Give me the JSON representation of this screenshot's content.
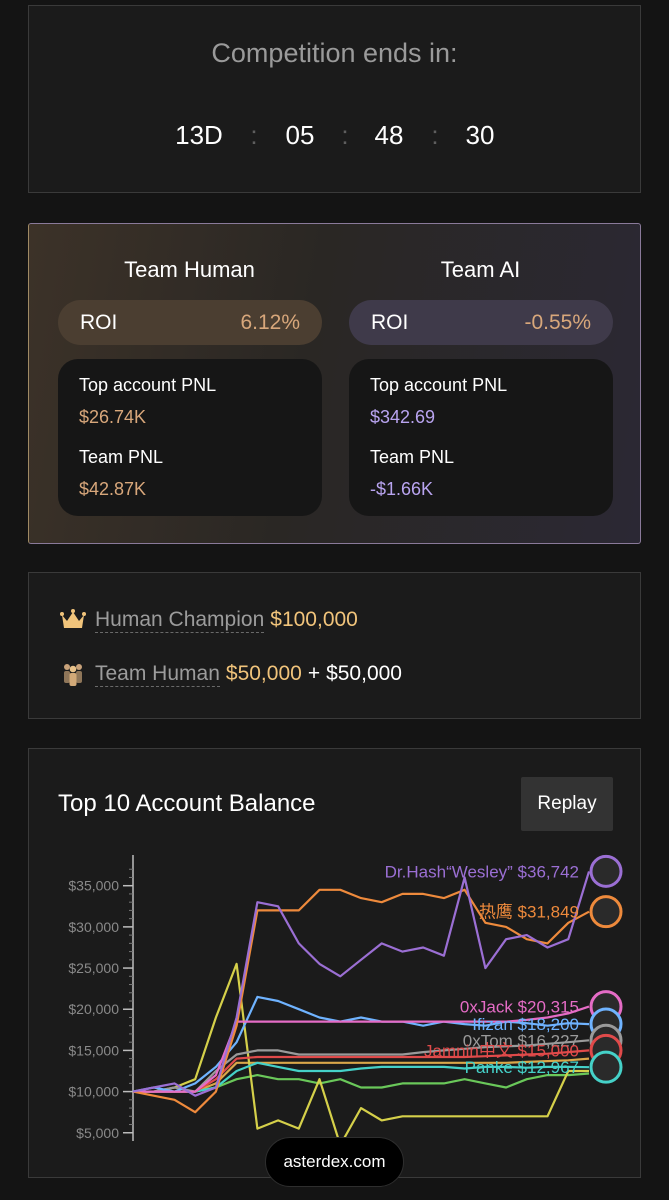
{
  "countdown": {
    "title": "Competition ends in:",
    "days": "13D",
    "hours": "05",
    "minutes": "48",
    "seconds": "30",
    "separator": ":"
  },
  "teams": [
    {
      "name": "Team Human",
      "roi_label": "ROI",
      "roi_value": "6.12%",
      "top_pnl_label": "Top account PNL",
      "top_pnl_value": "$26.74K",
      "team_pnl_label": "Team PNL",
      "team_pnl_value": "$42.87K",
      "accent": "#d8a77b"
    },
    {
      "name": "Team AI",
      "roi_label": "ROI",
      "roi_value": "-0.55%",
      "top_pnl_label": "Top account PNL",
      "top_pnl_value": "$342.69",
      "team_pnl_label": "Team PNL",
      "team_pnl_value": "-$1.66K",
      "accent": "#b9a4f0"
    }
  ],
  "prizes": {
    "champion_label": "Human Champion",
    "champion_amount": "$100,000",
    "team_label": "Team Human",
    "team_amount": "$50,000",
    "plus": "+",
    "team_bonus": "$50,000"
  },
  "chart_section": {
    "title": "Top 10 Account Balance",
    "replay_label": "Replay"
  },
  "chart_data": {
    "type": "line",
    "ylim": [
      4000,
      38000
    ],
    "yticks": [
      5000,
      10000,
      15000,
      20000,
      25000,
      30000,
      35000
    ],
    "ytick_labels": [
      "$5,000",
      "$10,000",
      "$15,000",
      "$20,000",
      "$25,000",
      "$30,000",
      "$35,000"
    ],
    "grid": false,
    "series": [
      {
        "name": "Dr.Hash“Wesley”",
        "label": "Dr.Hash“Wesley” $36,742",
        "final": 36742,
        "color": "#9b6fd4",
        "values": [
          10000,
          10500,
          11000,
          9500,
          10500,
          19000,
          33000,
          32500,
          28000,
          25500,
          24000,
          26000,
          28000,
          27000,
          27500,
          26500,
          36000,
          25000,
          28500,
          29000,
          27500,
          28500,
          36742
        ]
      },
      {
        "name": "热鹰",
        "label": "热鹰 $31,849",
        "final": 31849,
        "color": "#ee8a3c",
        "values": [
          10000,
          9500,
          9000,
          7500,
          10000,
          18000,
          32000,
          32000,
          32000,
          34500,
          34500,
          33500,
          33000,
          34000,
          34000,
          33500,
          34500,
          30500,
          30000,
          28500,
          28000,
          30500,
          31849
        ]
      },
      {
        "name": "0xJack",
        "label": "0xJack $20,315",
        "final": 20315,
        "color": "#e56cc6",
        "values": [
          10000,
          10000,
          10000,
          10000,
          12000,
          18500,
          18500,
          18500,
          18500,
          18500,
          18500,
          18500,
          18500,
          18500,
          18500,
          18500,
          18500,
          18500,
          18500,
          18700,
          19000,
          19500,
          20315
        ]
      },
      {
        "name": "Ifizan",
        "label": "Ifizan $18,200",
        "final": 18200,
        "color": "#6fb3ff",
        "values": [
          10000,
          10500,
          10000,
          11000,
          13000,
          16000,
          21500,
          21000,
          20000,
          19000,
          18500,
          19000,
          18500,
          18500,
          18000,
          18500,
          18200,
          18000,
          18500,
          18300,
          18000,
          18300,
          18200
        ]
      },
      {
        "name": "0xTom",
        "label": "0xTom $16,227",
        "final": 16227,
        "color": "#9a9a9a",
        "values": [
          10000,
          10000,
          10500,
          10000,
          12500,
          14500,
          15000,
          15000,
          14500,
          14500,
          14500,
          14500,
          14500,
          14500,
          14800,
          15000,
          15200,
          15400,
          15500,
          15600,
          15800,
          16000,
          16227
        ]
      },
      {
        "name": "Jamnin中文",
        "label": "Jamnin中文 $15,000",
        "final": 15000,
        "color": "#e04a4a",
        "values": [
          10000,
          10000,
          10000,
          10000,
          11500,
          14000,
          14200,
          14200,
          14200,
          14200,
          14200,
          14200,
          14200,
          14200,
          14200,
          14200,
          14200,
          14300,
          14400,
          14500,
          14600,
          14800,
          15000
        ]
      },
      {
        "name": "Panke",
        "label": "Panke $12,967",
        "final": 12967,
        "color": "#45d1c8",
        "values": [
          10000,
          10000,
          10000,
          10000,
          10500,
          12500,
          13500,
          13000,
          12500,
          12500,
          12500,
          12800,
          13000,
          13000,
          13000,
          13000,
          12800,
          13000,
          13000,
          12900,
          13000,
          13000,
          12967
        ]
      },
      {
        "name": "",
        "label": "",
        "final": 12500,
        "color": "#d5d04a",
        "values": [
          10000,
          10000,
          10500,
          11500,
          19000,
          25500,
          5500,
          6500,
          5500,
          11500,
          3500,
          8000,
          6500,
          7000,
          7000,
          7000,
          7000,
          7000,
          7000,
          7000,
          7000,
          12500,
          12500
        ]
      },
      {
        "name": "",
        "label": "",
        "final": 12200,
        "color": "#6ac85a",
        "values": [
          10000,
          10000,
          10000,
          10000,
          10500,
          11500,
          12000,
          11500,
          11500,
          11000,
          11500,
          10500,
          10500,
          11000,
          11000,
          11000,
          11500,
          11000,
          10500,
          11500,
          12000,
          12000,
          12200
        ]
      },
      {
        "name": "",
        "label": "",
        "final": 14000,
        "color": "#d9a74a",
        "values": [
          10000,
          10000,
          10000,
          10000,
          11000,
          13500,
          13500,
          13500,
          13500,
          13500,
          13500,
          13500,
          13500,
          13500,
          13500,
          13500,
          13500,
          13500,
          13500,
          13600,
          13700,
          13800,
          14000
        ]
      }
    ]
  },
  "footer": {
    "site": "asterdex.com"
  }
}
